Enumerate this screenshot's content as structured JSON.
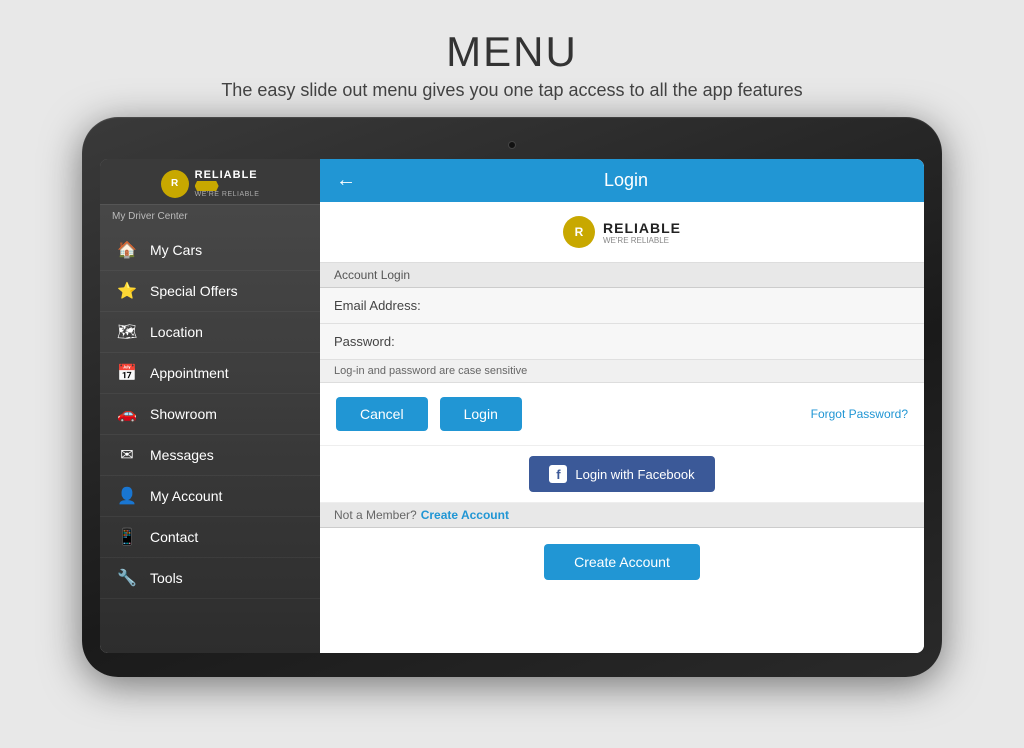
{
  "header": {
    "title": "MENU",
    "subtitle": "The easy slide out menu gives you one tap access to all the app features"
  },
  "sidebar": {
    "logo_text": "RELIABLE",
    "logo_tagline": "WE'RE RELIABLE",
    "driver_center_label": "My Driver Center",
    "menu_items": [
      {
        "id": "my-cars",
        "label": "My Cars",
        "icon": "🏠"
      },
      {
        "id": "special-offers",
        "label": "Special Offers",
        "icon": "⭐"
      },
      {
        "id": "location",
        "label": "Location",
        "icon": "📋"
      },
      {
        "id": "appointment",
        "label": "Appointment",
        "icon": "📅"
      },
      {
        "id": "showroom",
        "label": "Showroom",
        "icon": "🚗"
      },
      {
        "id": "messages",
        "label": "Messages",
        "icon": "✉"
      },
      {
        "id": "my-account",
        "label": "My Account",
        "icon": "👤"
      },
      {
        "id": "contact",
        "label": "Contact",
        "icon": "📞"
      },
      {
        "id": "tools",
        "label": "Tools",
        "icon": "🔧"
      }
    ]
  },
  "login_panel": {
    "header_title": "Login",
    "back_arrow": "←",
    "logo_text": "RELIABLE",
    "logo_sub": "WE'RE RELIABLE",
    "account_login_label": "Account Login",
    "email_label": "Email Address:",
    "email_placeholder": "",
    "password_label": "Password:",
    "password_placeholder": "",
    "case_note": "Log-in and password are case sensitive",
    "cancel_btn": "Cancel",
    "login_btn": "Login",
    "forgot_password": "Forgot Password?",
    "facebook_btn": "Login with Facebook",
    "not_member_text": "Not a Member?",
    "create_account_link": "Create Account",
    "create_account_btn": "Create Account"
  }
}
